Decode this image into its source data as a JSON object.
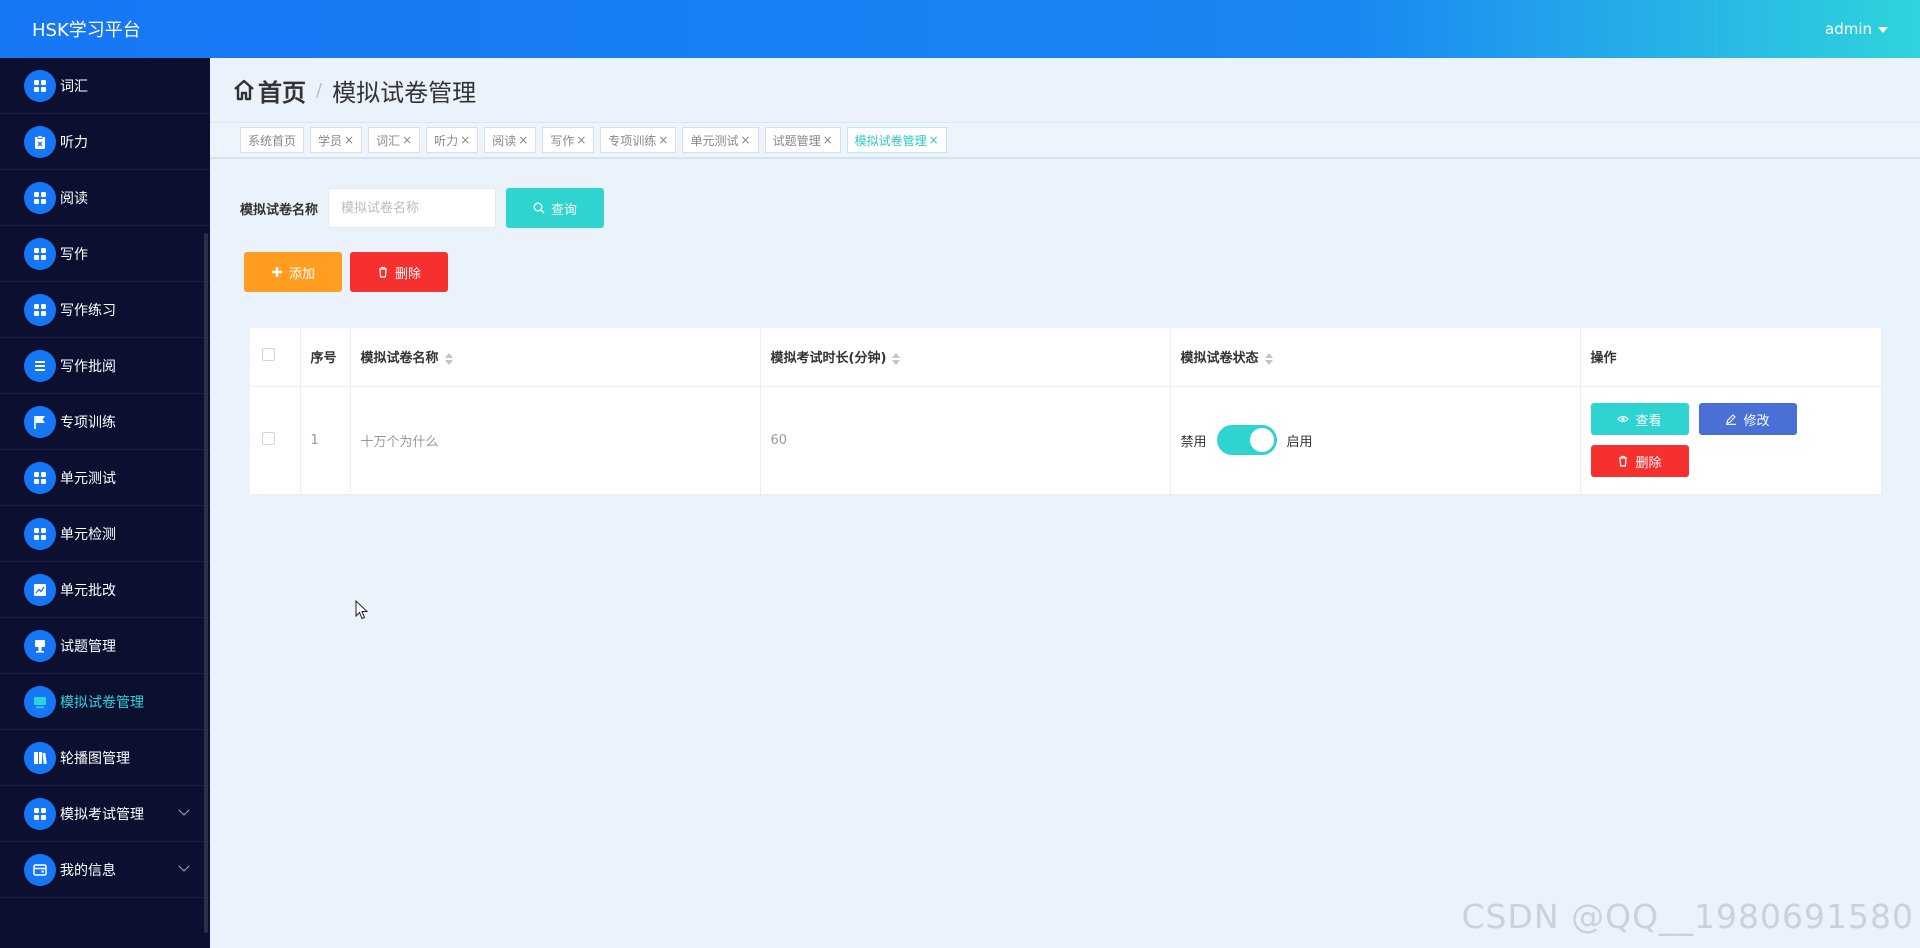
{
  "header": {
    "brand": "HSK学习平台",
    "user": "admin"
  },
  "sidebar": {
    "items": [
      {
        "label": "词汇",
        "icon": "grid-icon"
      },
      {
        "label": "听力",
        "icon": "clipboard-icon"
      },
      {
        "label": "阅读",
        "icon": "grid-icon"
      },
      {
        "label": "写作",
        "icon": "grid-icon"
      },
      {
        "label": "写作练习",
        "icon": "grid-icon"
      },
      {
        "label": "写作批阅",
        "icon": "list-icon"
      },
      {
        "label": "专项训练",
        "icon": "flag-icon"
      },
      {
        "label": "单元测试",
        "icon": "grid-icon"
      },
      {
        "label": "单元检测",
        "icon": "grid-icon"
      },
      {
        "label": "单元批改",
        "icon": "chart-icon"
      },
      {
        "label": "试题管理",
        "icon": "stamp-icon"
      },
      {
        "label": "模拟试卷管理",
        "icon": "monitor-icon",
        "active": true
      },
      {
        "label": "轮播图管理",
        "icon": "book-icon"
      },
      {
        "label": "模拟考试管理",
        "icon": "grid-icon",
        "expandable": true
      },
      {
        "label": "我的信息",
        "icon": "wallet-icon",
        "expandable": true
      }
    ]
  },
  "breadcrumb": {
    "home": "首页",
    "separator": "/",
    "current": "模拟试卷管理"
  },
  "tags": [
    {
      "label": "系统首页",
      "closable": false
    },
    {
      "label": "学员",
      "closable": true
    },
    {
      "label": "词汇",
      "closable": true
    },
    {
      "label": "听力",
      "closable": true
    },
    {
      "label": "阅读",
      "closable": true
    },
    {
      "label": "写作",
      "closable": true
    },
    {
      "label": "专项训练",
      "closable": true
    },
    {
      "label": "单元测试",
      "closable": true
    },
    {
      "label": "试题管理",
      "closable": true
    },
    {
      "label": "模拟试卷管理",
      "closable": true,
      "active": true
    }
  ],
  "search": {
    "label": "模拟试卷名称",
    "placeholder": "模拟试卷名称",
    "value": "",
    "button": "查询"
  },
  "actions": {
    "add": "添加",
    "delete": "删除"
  },
  "table": {
    "columns": [
      "序号",
      "模拟试卷名称",
      "模拟考试时长(分钟)",
      "模拟试卷状态",
      "操作"
    ],
    "rows": [
      {
        "index": "1",
        "name": "十万个为什么",
        "duration": "60",
        "status_off": "禁用",
        "status_on": "启用",
        "enabled": true
      }
    ],
    "row_actions": {
      "view": "查看",
      "edit": "修改",
      "delete": "删除"
    }
  },
  "watermark": "CSDN @QQ__1980691580",
  "colors": {
    "primary": "#1677f5",
    "teal": "#2fd3d0",
    "orange": "#ff9e20",
    "red": "#f5302f",
    "blue": "#4a70d8",
    "sidebar": "#0b1030"
  }
}
